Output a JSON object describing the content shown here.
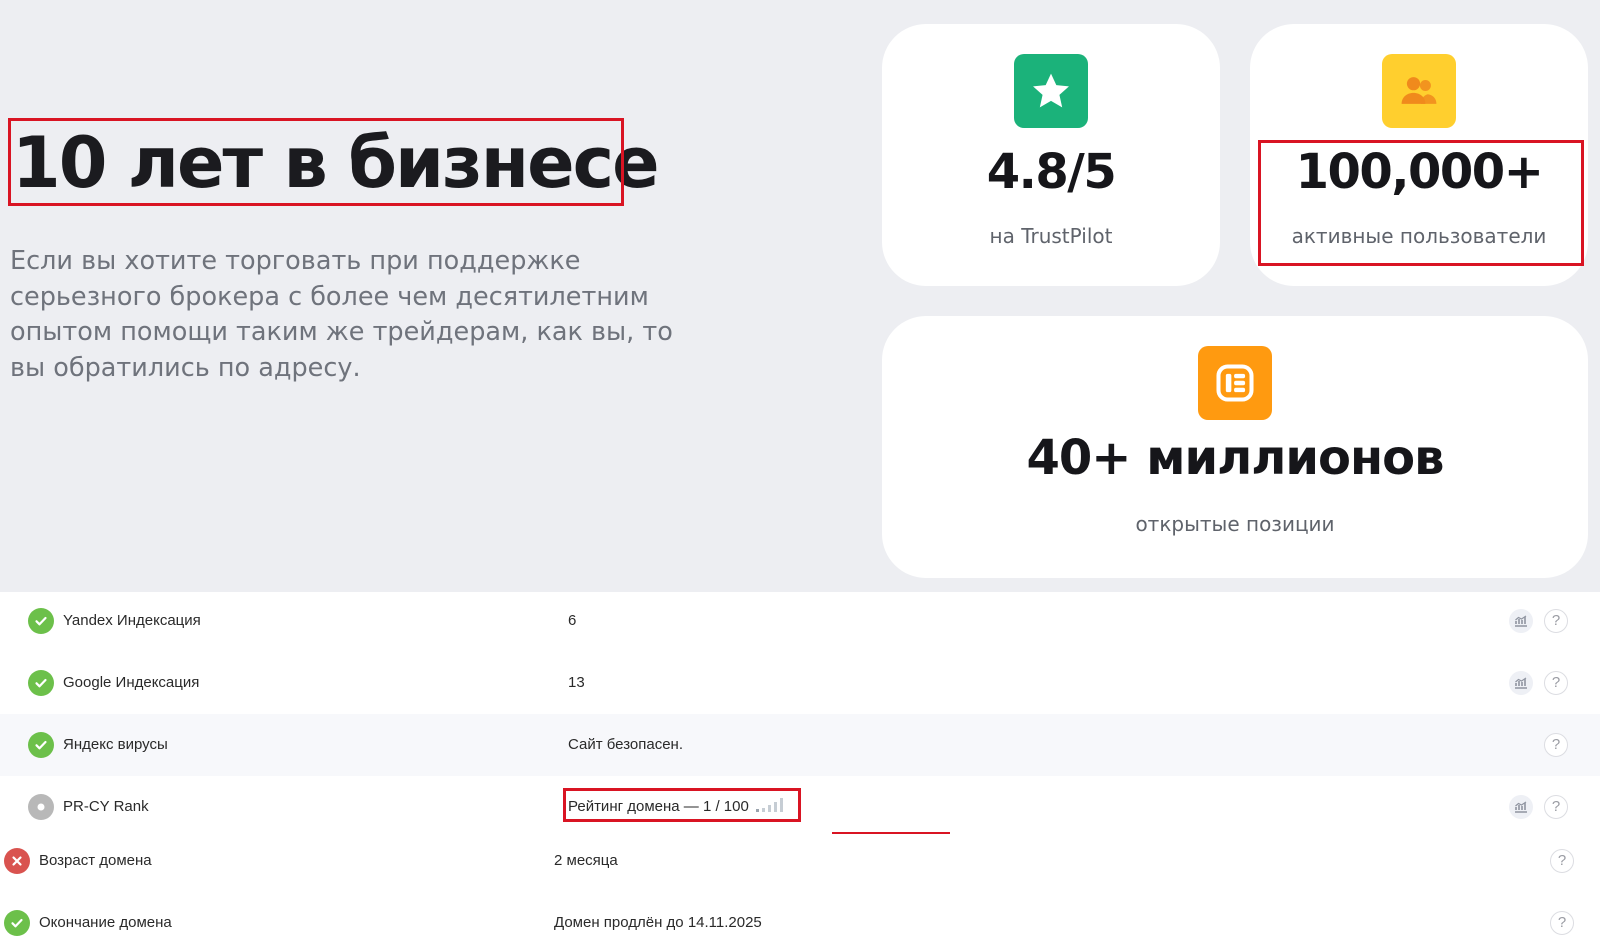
{
  "hero": {
    "title": "10 лет в бизнесе",
    "description": "Если вы хотите торговать при поддержке серьезного брокера с более чем десятилетним опытом помощи таким же трейдерам, как вы, то вы обратились по адресу."
  },
  "cards": {
    "trust": {
      "icon": "star-icon",
      "value": "4.8/5",
      "label": "на TrustPilot"
    },
    "users": {
      "icon": "users-icon",
      "value": "100,000+",
      "label": "активные пользователи"
    },
    "positions": {
      "icon": "positions-icon",
      "value": "40+ миллионов",
      "label": "открытые позиции"
    }
  },
  "metrics": {
    "rows": [
      {
        "label": "Yandex Индексация",
        "value": "6",
        "status": "ok",
        "has_chart": true
      },
      {
        "label": "Google Индексация",
        "value": "13",
        "status": "ok",
        "has_chart": true
      },
      {
        "label": "Яндекс вирусы",
        "value": "Сайт безопасен.",
        "status": "ok",
        "has_chart": false
      },
      {
        "label": "PR-CY Rank",
        "value": "Рейтинг домена — 1 / 100",
        "status": "neutral",
        "has_chart": true
      },
      {
        "label": "Возраст домена",
        "value": "2 месяца",
        "status": "bad",
        "has_chart": false
      },
      {
        "label": "Окончание домена",
        "value": "Домен продлён до 14.11.2025",
        "status": "ok",
        "has_chart": false
      }
    ],
    "help_glyph": "?"
  },
  "colors": {
    "highlight": "#d91423",
    "ok": "#6cc04a",
    "bad": "#d9534f",
    "trustpilot": "#1bb27a",
    "users": "#ffcf2e",
    "positions": "#ff9a10"
  }
}
